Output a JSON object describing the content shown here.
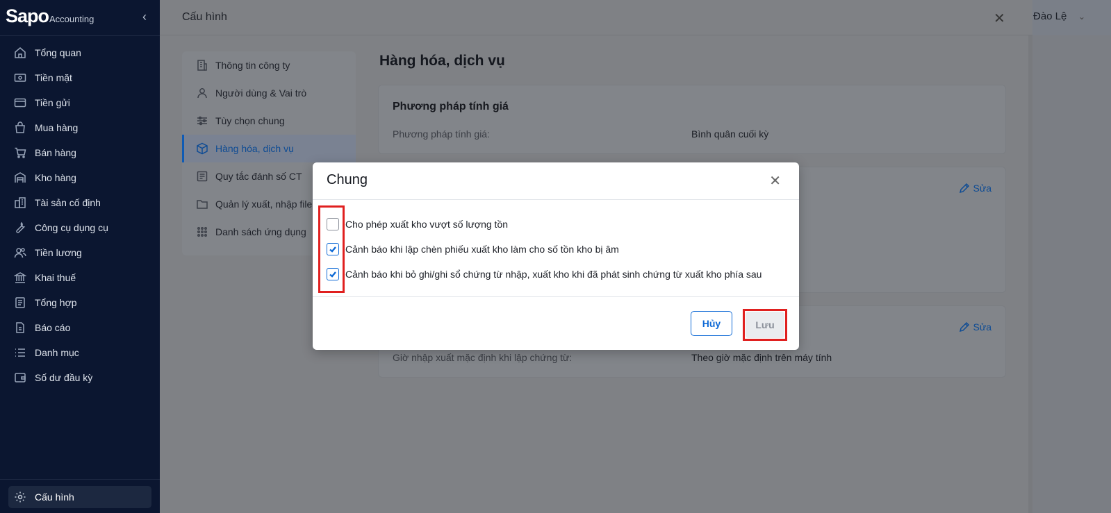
{
  "app": {
    "logo_main": "Sapo",
    "logo_sub": "Accounting",
    "collapse_icon": "chevron-left-icon"
  },
  "sidebar": {
    "items": [
      {
        "label": "Tổng quan",
        "icon": "home-icon"
      },
      {
        "label": "Tiền mặt",
        "icon": "cash-icon"
      },
      {
        "label": "Tiền gửi",
        "icon": "card-icon"
      },
      {
        "label": "Mua hàng",
        "icon": "bag-icon"
      },
      {
        "label": "Bán hàng",
        "icon": "cart-icon"
      },
      {
        "label": "Kho hàng",
        "icon": "warehouse-icon"
      },
      {
        "label": "Tài sản cố định",
        "icon": "building-icon"
      },
      {
        "label": "Công cụ dụng cụ",
        "icon": "tool-icon"
      },
      {
        "label": "Tiền lương",
        "icon": "people-icon"
      },
      {
        "label": "Khai thuế",
        "icon": "bank-icon"
      },
      {
        "label": "Tổng hợp",
        "icon": "ledger-icon"
      },
      {
        "label": "Báo cáo",
        "icon": "report-icon"
      },
      {
        "label": "Danh mục",
        "icon": "list-icon"
      },
      {
        "label": "Số dư đầu kỳ",
        "icon": "wallet-icon"
      }
    ],
    "config_label": "Cấu hình"
  },
  "user": {
    "name": "Đào Lệ"
  },
  "panel": {
    "title": "Cấu hình",
    "menu": [
      {
        "label": "Thông tin công ty",
        "active": false
      },
      {
        "label": "Người dùng & Vai trò",
        "active": false
      },
      {
        "label": "Tùy chọn chung",
        "active": false
      },
      {
        "label": "Hàng hóa, dịch vụ",
        "active": true
      },
      {
        "label": "Quy tắc đánh số CT",
        "active": false
      },
      {
        "label": "Quản lý xuất, nhập file",
        "active": false
      },
      {
        "label": "Danh sách ứng dụng",
        "active": false
      }
    ],
    "section_title": "Hàng hóa, dịch vụ",
    "card1": {
      "title": "Phương pháp tính giá",
      "label": "Phương pháp tính giá:",
      "value": "Bình quân cuối kỳ"
    },
    "card2": {
      "edit_label": "Sửa"
    },
    "card3": {
      "edit_label": "Sửa",
      "label": "Giờ nhập xuất mặc định khi lập chứng từ:",
      "value": "Theo giờ mặc định trên máy tính"
    }
  },
  "modal": {
    "title": "Chung",
    "options": [
      {
        "label": "Cho phép xuất kho vượt số lượng tồn",
        "checked": false
      },
      {
        "label": "Cảnh báo khi lập chèn phiếu xuất kho làm cho số tồn kho bị âm",
        "checked": true
      },
      {
        "label": "Cảnh báo khi bỏ ghi/ghi sổ chứng từ nhập, xuất kho khi đã phát sinh chứng từ xuất kho phía sau",
        "checked": true
      }
    ],
    "cancel_label": "Hủy",
    "save_label": "Lưu"
  },
  "colors": {
    "sidebar_bg": "#0b1630",
    "accent": "#0f6ad6",
    "highlight": "#e0201f"
  }
}
